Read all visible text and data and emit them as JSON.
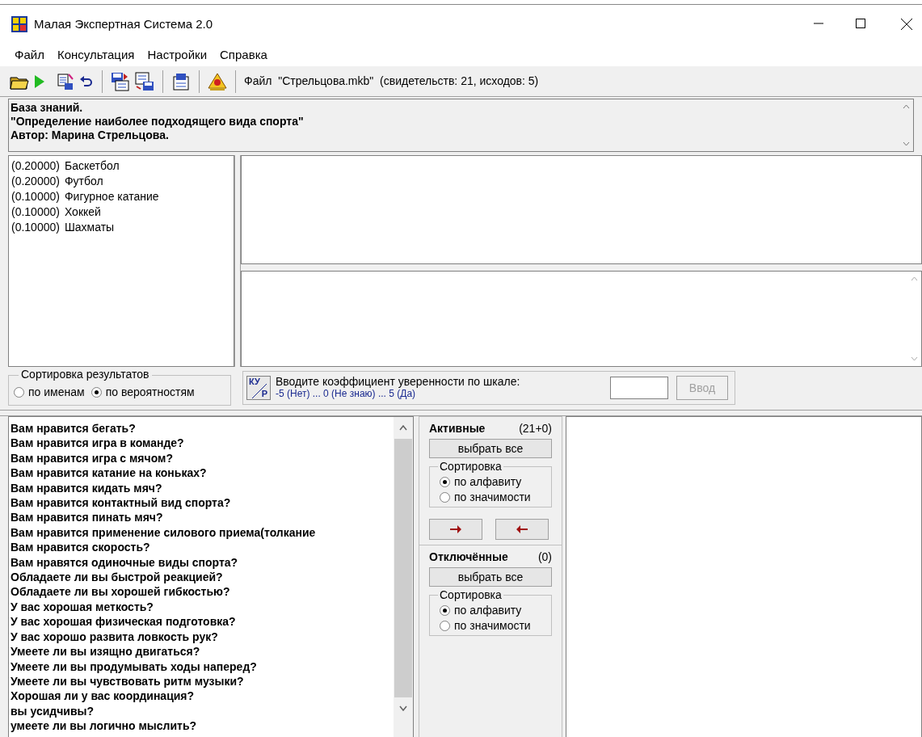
{
  "window": {
    "title": "Малая Экспертная Система 2.0"
  },
  "menu": [
    {
      "label": "Файл"
    },
    {
      "label": "Консультация"
    },
    {
      "label": "Настройки"
    },
    {
      "label": "Справка"
    }
  ],
  "toolbar": {
    "file_info": "Файл  \"Стрельцова.mkb\"  (свидетельств: 21, исходов: 5)"
  },
  "knowledge_base": [
    "База знаний.",
    "\"Определение наиболее подходящего вида спорта\"",
    "Автор: Марина Стрельцова."
  ],
  "results": [
    {
      "probability": "(0.20000)",
      "name": "Баскетбол"
    },
    {
      "probability": "(0.20000)",
      "name": "Футбол"
    },
    {
      "probability": "(0.10000)",
      "name": "Фигурное катание"
    },
    {
      "probability": "(0.10000)",
      "name": "Хоккей"
    },
    {
      "probability": "(0.10000)",
      "name": "Шахматы"
    }
  ],
  "result_sort": {
    "title": "Сортировка результатов",
    "options": [
      {
        "label": "по именам",
        "selected": false
      },
      {
        "label": "по вероятностям",
        "selected": true
      }
    ]
  },
  "input": {
    "badge_top": "КУ",
    "badge_bottom": "Р",
    "prompt": "Вводите коэффициент уверенности по шкале:",
    "scale": "-5 (Нет) ... 0 (Не знаю) ... 5 (Да)",
    "button": "Ввод",
    "disabled": true
  },
  "questions": [
    "Вам нравится бегать?",
    "Вам нравится игра в команде?",
    "Вам нравится игра с мячом?",
    "Вам нравится катание на коньках?",
    "Вам нравится кидать мяч?",
    "Вам нравится контактный вид спорта?",
    "Вам нравится пинать мяч?",
    "Вам нравится применение силового приема(толкание",
    "Вам нравится скорость?",
    "Вам нравятся одиночные виды спорта?",
    "Обладаете ли вы быстрой реакцией?",
    "Обладаете ли вы хорошей гибкостью?",
    "У вас хорошая меткость?",
    "У вас хорошая физическая подготовка?",
    "У вас хорошо развита ловкость рук?",
    "Умеете ли вы изящно двигаться?",
    "Умеете ли вы продумывать ходы наперед?",
    "Умеете ли вы чувствовать ритм музыки?",
    "Хорошая ли у вас координация?",
    "вы усидчивы?",
    "умеете ли вы логично мыслить?"
  ],
  "groups": [
    {
      "title": "Активные",
      "count": "(21+0)",
      "select_all": "выбрать все",
      "sort_title": "Сортировка",
      "sort_options": [
        {
          "label": "по алфавиту",
          "selected": true
        },
        {
          "label": "по значимости",
          "selected": false
        }
      ]
    },
    {
      "title": "Отключённые",
      "count": "(0)",
      "select_all": "выбрать все",
      "sort_title": "Сортировка",
      "sort_options": [
        {
          "label": "по алфавиту",
          "selected": true
        },
        {
          "label": "по значимости",
          "selected": false
        }
      ]
    }
  ]
}
